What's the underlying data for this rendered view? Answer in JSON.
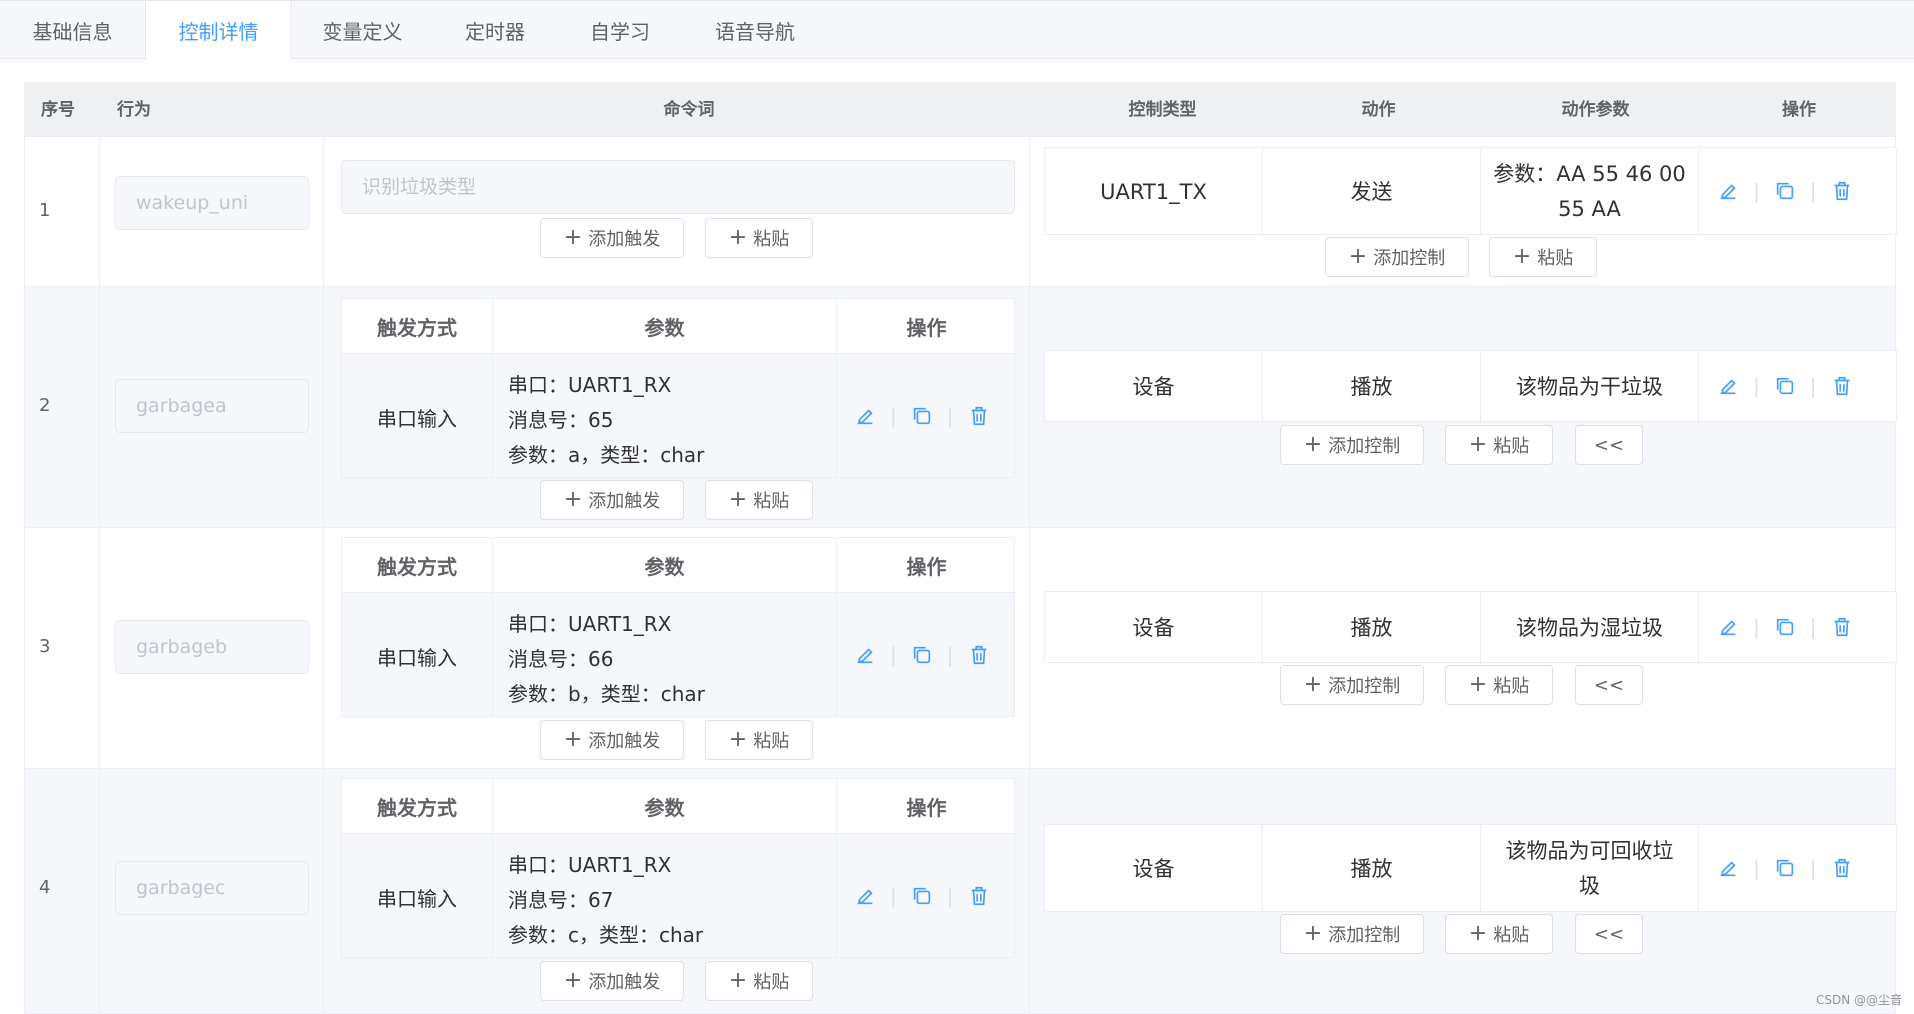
{
  "tabs": [
    {
      "label": "基础信息",
      "active": false
    },
    {
      "label": "控制详情",
      "active": true
    },
    {
      "label": "变量定义",
      "active": false
    },
    {
      "label": "定时器",
      "active": false
    },
    {
      "label": "自学习",
      "active": false
    },
    {
      "label": "语音导航",
      "active": false
    }
  ],
  "table": {
    "headers": {
      "no": "序号",
      "behavior": "行为",
      "command": "命令词",
      "control_type": "控制类型",
      "action": "动作",
      "action_params": "动作参数",
      "ops": "操作"
    },
    "sub_headers": {
      "trigger": "触发方式",
      "params": "参数",
      "ops": "操作"
    },
    "buttons": {
      "add_trigger": "添加触发",
      "paste": "粘贴",
      "add_control": "添加控制",
      "collapse": "<<"
    },
    "rows": [
      {
        "no": "1",
        "behavior": "wakeup_uni",
        "command_placeholder": "识别垃圾类型",
        "control": {
          "type": "UART1_TX",
          "action": "发送",
          "param_line1": "参数：AA 55 46 00",
          "param_line2": "55 AA"
        }
      },
      {
        "no": "2",
        "behavior": "garbagea",
        "trigger": {
          "mode": "串口输入",
          "line1": "串口：UART1_RX",
          "line2": "消息号：65",
          "line3": "参数：a，类型：char"
        },
        "control": {
          "type": "设备",
          "action": "播放",
          "param_line1": "该物品为干垃圾",
          "param_line2": ""
        }
      },
      {
        "no": "3",
        "behavior": "garbageb",
        "trigger": {
          "mode": "串口输入",
          "line1": "串口：UART1_RX",
          "line2": "消息号：66",
          "line3": "参数：b，类型：char"
        },
        "control": {
          "type": "设备",
          "action": "播放",
          "param_line1": "该物品为湿垃圾",
          "param_line2": ""
        }
      },
      {
        "no": "4",
        "behavior": "garbagec",
        "trigger": {
          "mode": "串口输入",
          "line1": "串口：UART1_RX",
          "line2": "消息号：67",
          "line3": "参数：c，类型：char"
        },
        "control": {
          "type": "设备",
          "action": "播放",
          "param_line1": "该物品为可回收垃",
          "param_line2": "圾"
        }
      }
    ]
  },
  "footer": "CSDN @@尘音",
  "colors": {
    "accent": "#409eff",
    "header_bg": "#eff0f2",
    "row_alt": "#f5f7fa"
  }
}
